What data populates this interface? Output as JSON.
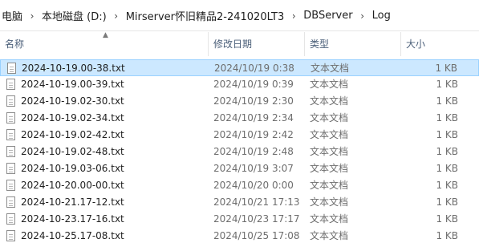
{
  "breadcrumb": {
    "items": [
      "电脑",
      "本地磁盘 (D:)",
      "Mirserver怀旧精品2-241020LT3",
      "DBServer",
      "Log"
    ],
    "separator": "›"
  },
  "columns": {
    "name": "名称",
    "modified": "修改日期",
    "type": "类型",
    "size": "大小"
  },
  "files": [
    {
      "name": "2024-10-19.00-38.txt",
      "modified": "2024/10/19 0:38",
      "type": "文本文档",
      "size": "1 KB",
      "selected": true
    },
    {
      "name": "2024-10-19.00-39.txt",
      "modified": "2024/10/19 0:39",
      "type": "文本文档",
      "size": "1 KB"
    },
    {
      "name": "2024-10-19.02-30.txt",
      "modified": "2024/10/19 2:30",
      "type": "文本文档",
      "size": "1 KB"
    },
    {
      "name": "2024-10-19.02-34.txt",
      "modified": "2024/10/19 2:34",
      "type": "文本文档",
      "size": "1 KB"
    },
    {
      "name": "2024-10-19.02-42.txt",
      "modified": "2024/10/19 2:42",
      "type": "文本文档",
      "size": "1 KB"
    },
    {
      "name": "2024-10-19.02-48.txt",
      "modified": "2024/10/19 2:48",
      "type": "文本文档",
      "size": "1 KB"
    },
    {
      "name": "2024-10-19.03-06.txt",
      "modified": "2024/10/19 3:07",
      "type": "文本文档",
      "size": "1 KB"
    },
    {
      "name": "2024-10-20.00-00.txt",
      "modified": "2024/10/20 0:00",
      "type": "文本文档",
      "size": "1 KB"
    },
    {
      "name": "2024-10-21.17-12.txt",
      "modified": "2024/10/21 17:13",
      "type": "文本文档",
      "size": "1 KB"
    },
    {
      "name": "2024-10-23.17-16.txt",
      "modified": "2024/10/23 17:17",
      "type": "文本文档",
      "size": "1 KB"
    },
    {
      "name": "2024-10-25.17-08.txt",
      "modified": "2024/10/25 17:08",
      "type": "文本文档",
      "size": "1 KB"
    }
  ]
}
